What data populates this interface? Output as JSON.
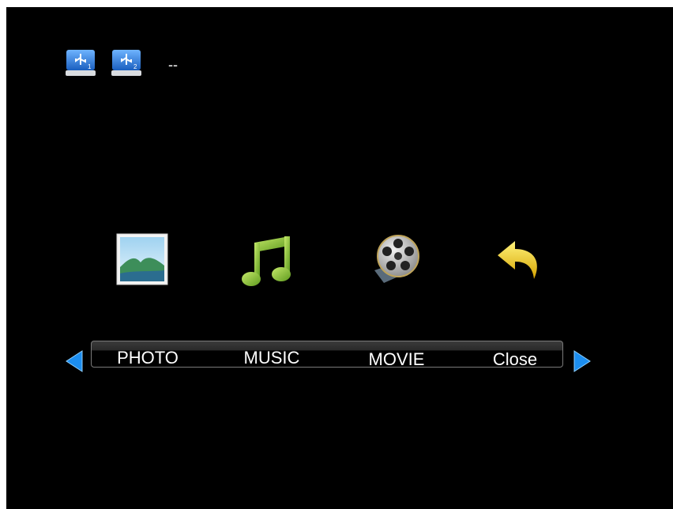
{
  "usb_devices": [
    {
      "name": "usb-device-1",
      "index": "1",
      "icon": "usb-drive-icon"
    },
    {
      "name": "usb-device-2",
      "index": "2",
      "icon": "usb-drive-icon"
    }
  ],
  "usb_status": "--",
  "menu": {
    "items": [
      {
        "label": "PHOTO",
        "icon": "photo-icon"
      },
      {
        "label": "MUSIC",
        "icon": "music-note-icon"
      },
      {
        "label": "MOVIE",
        "icon": "film-reel-icon"
      },
      {
        "label": "Close",
        "icon": "back-arrow-icon"
      }
    ]
  },
  "colors": {
    "background": "#000000",
    "text": "#ffffff",
    "arrow": "#1c8ef0",
    "music": "#8cc43a",
    "close_arrow": "#f2d21e"
  }
}
